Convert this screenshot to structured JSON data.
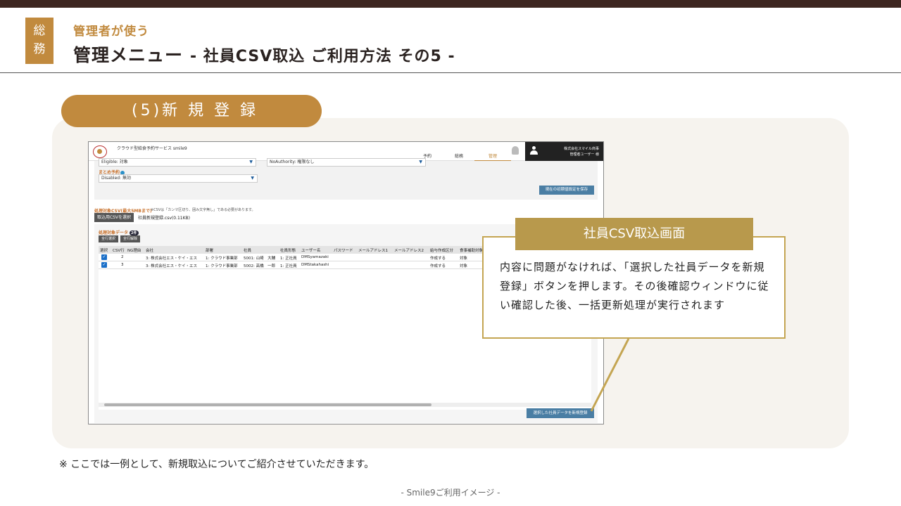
{
  "header": {
    "category": "総務",
    "subtitle": "管理者が使う",
    "title": "管理メニュー",
    "title_sub": "- 社員CSV取込 ご利用方法 その5 -"
  },
  "step": {
    "label": "(5)新 規 登 録"
  },
  "app": {
    "service_name": "クラウド型給食予約サービス smile9",
    "nav": [
      "予約",
      "総務",
      "管理"
    ],
    "active_nav": "管理",
    "user_company": "株式会社スマイル商事",
    "user_name": "管理者ユーザー 様",
    "form": {
      "field1_value": "Eligible: 対象",
      "field2_value": "NoAuthority: 権限なし",
      "label_bulk": "まとめ予約",
      "field3_value": "Disabled: 無効",
      "save_button": "現在の初期値設定を保存"
    },
    "csv": {
      "label": "処理対象CSV(最大5MBまで)",
      "note": "※CSVは「カンマ区切り、囲み文字無し」である必要があります。",
      "select_button": "取込用CSVを選択",
      "file_name": "社員新規登録.csv(0.11KB)"
    },
    "data": {
      "label": "処理対象データ",
      "count": "2件",
      "select_all": "全行選択",
      "deselect_all": "全行解除",
      "columns": [
        "選択",
        "CSV行",
        "NG理由",
        "会社",
        "部署",
        "社員",
        "社員形態",
        "ユーザー名",
        "パスワード",
        "メールアドレス1",
        "メールアドレス2",
        "給与作成区分",
        "食事補助対象"
      ],
      "rows": [
        {
          "csv_row": "2",
          "company": "3: 株式会社エス・ケイ・エス",
          "dept": "1: クラウド事業部",
          "employee": "5001: 山崎　大輔",
          "type": "1: 正社員",
          "username": "DMSyamazaki",
          "payroll": "作成する",
          "meal": "対象"
        },
        {
          "csv_row": "3",
          "company": "3: 株式会社エス・ケイ・エス",
          "dept": "1: クラウド事業部",
          "employee": "5002: 高橋　一郎",
          "type": "1: 正社員",
          "username": "DMStakahashi",
          "payroll": "作成する",
          "meal": "対象"
        }
      ],
      "register_button": "選択した社員データを新規登録"
    }
  },
  "callout": {
    "title": "社員CSV取込画面",
    "body": "内容に問題がなければ、「選択した社員データを新規登録」ボタンを押します。その後確認ウィンドウに従い確認した後、一括更新処理が実行されます"
  },
  "footnote": "※ ここでは一例として、新規取込についてご紹介させていただきます。",
  "footer": "- Smile9ご利用イメージ -",
  "colors": {
    "accent": "#c18a3e",
    "dark": "#3d2620",
    "callout_border": "#c4a552",
    "button_blue": "#4a7ea4"
  }
}
